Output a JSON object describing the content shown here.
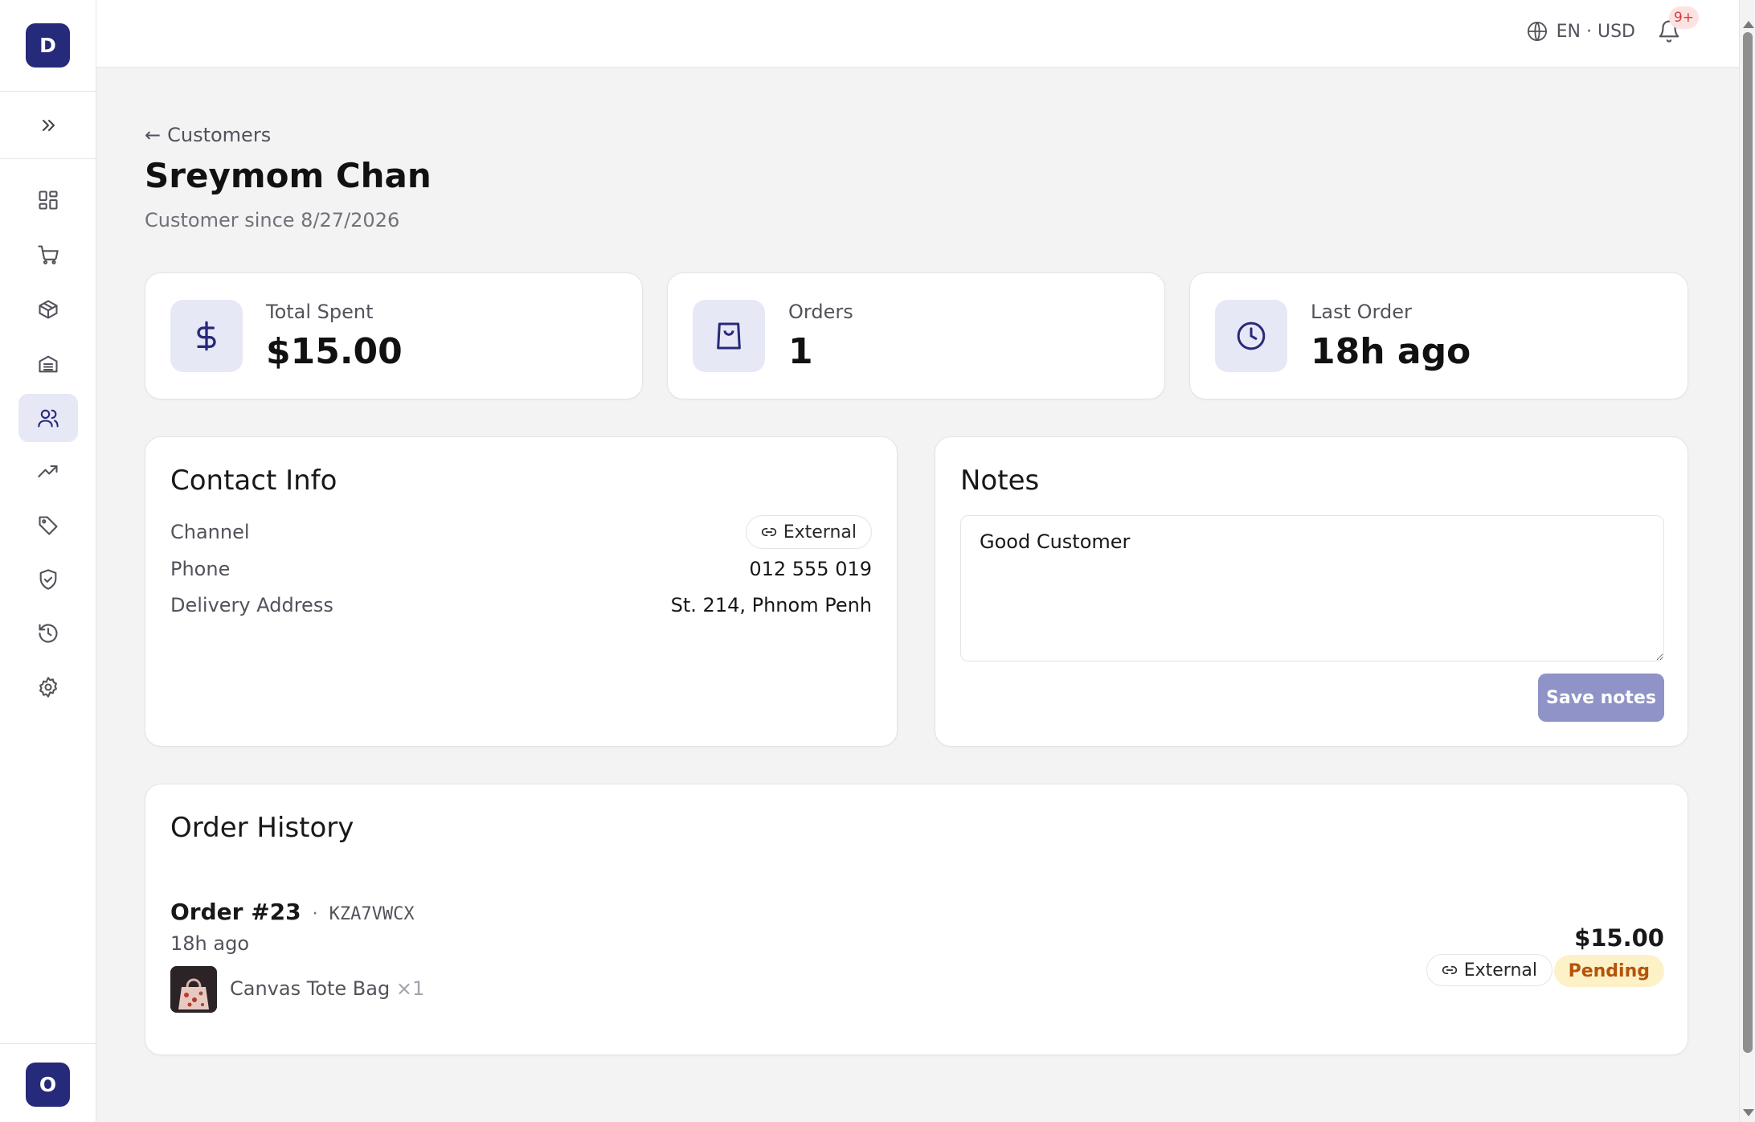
{
  "app": {
    "logo_letter": "D",
    "user_initial": "O",
    "accent_color": "#262a7a"
  },
  "sidebar": {
    "items": [
      {
        "icon": "dashboard-icon"
      },
      {
        "icon": "cart-icon"
      },
      {
        "icon": "box-icon"
      },
      {
        "icon": "inventory-icon"
      },
      {
        "icon": "users-icon",
        "active": true
      },
      {
        "icon": "trending-icon"
      },
      {
        "icon": "tag-icon"
      },
      {
        "icon": "shield-icon"
      },
      {
        "icon": "history-icon"
      },
      {
        "icon": "gear-icon"
      }
    ]
  },
  "topbar": {
    "locale": "EN · USD",
    "notifications_badge": "9+"
  },
  "page": {
    "back_label": "Customers",
    "title": "Sreymom Chan",
    "subtitle": "Customer since 8/27/2026"
  },
  "stats": [
    {
      "label": "Total Spent",
      "value": "$15.00",
      "icon": "dollar-icon"
    },
    {
      "label": "Orders",
      "value": "1",
      "icon": "shopping-bag-icon"
    },
    {
      "label": "Last Order",
      "value": "18h ago",
      "icon": "clock-icon"
    }
  ],
  "contact": {
    "title": "Contact Info",
    "channel_label": "Channel",
    "channel_value": "External",
    "phone_label": "Phone",
    "phone_value": "012 555 019",
    "address_label": "Delivery Address",
    "address_value": "St. 214, Phnom Penh"
  },
  "notes": {
    "title": "Notes",
    "value": "Good Customer",
    "save_label": "Save notes"
  },
  "order_history": {
    "title": "Order History",
    "orders": [
      {
        "number": "Order #23",
        "separator": "·",
        "code": "KZA7VWCX",
        "time": "18h ago",
        "item_name": "Canvas Tote Bag",
        "item_qty": "×1",
        "amount": "$15.00",
        "channel": "External",
        "status": "Pending"
      }
    ]
  }
}
